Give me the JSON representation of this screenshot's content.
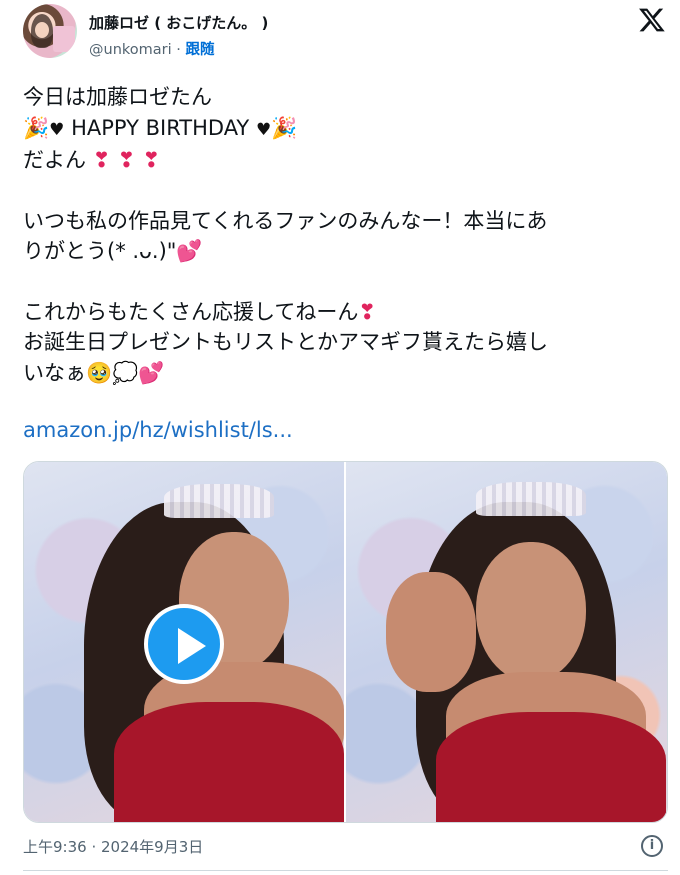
{
  "header": {
    "display_name": "加藤ロゼ ( おこげたん。 )",
    "handle": "@unkomari",
    "separator": "·",
    "follow_label": "跟随"
  },
  "tweet": {
    "line1": "今日は加藤ロゼたん",
    "line2_emoji_left": "🎉",
    "line2_heart": "♥",
    "line2_text": " HAPPY BIRTHDAY ",
    "line3_text": "だよん",
    "line3_marks": "❣ ❣ ❣",
    "line4": "いつも私の作品見てくれるファンのみんなー！本当にあ",
    "line5_text": "りがとう(* .ᴗ.)\"",
    "line5_emoji": "💕",
    "line6_text": "これからもたくさん応援してねーん",
    "line6_mark": "❣",
    "line7": "お誕生日プレゼントもリストとかアマギフ貰えたら嬉し",
    "line8_text": "いなぁ",
    "line8_emoji": "🥹💭💕",
    "link": "amazon.jp/hz/wishlist/ls..."
  },
  "footer": {
    "timestamp": "上午9:36 · 2024年9月3日",
    "info_glyph": "i"
  },
  "colors": {
    "link": "#1d6fc4",
    "follow": "#006fd6",
    "muted": "#536471",
    "play_button": "#1d9bf0"
  }
}
